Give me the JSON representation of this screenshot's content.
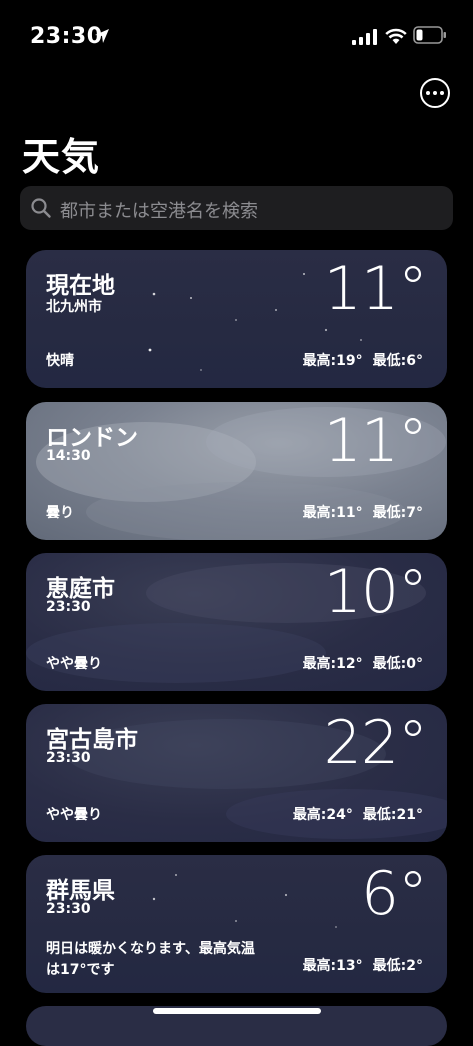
{
  "status_bar": {
    "time": "23:30"
  },
  "header": {
    "title": "天気"
  },
  "search": {
    "placeholder": "都市または空港名を検索"
  },
  "cities": [
    {
      "name": "現在地",
      "subtitle": "北九州市",
      "temp": "11°",
      "condition": "快晴",
      "high": "最高:19°",
      "low": "最低:6°",
      "theme": "night"
    },
    {
      "name": "ロンドン",
      "subtitle": "14:30",
      "temp": "11°",
      "condition": "曇り",
      "high": "最高:11°",
      "low": "最低:7°",
      "theme": "day"
    },
    {
      "name": "恵庭市",
      "subtitle": "23:30",
      "temp": "10°",
      "condition": "やや曇り",
      "high": "最高:12°",
      "low": "最低:0°",
      "theme": "cloudy-night"
    },
    {
      "name": "宮古島市",
      "subtitle": "23:30",
      "temp": "22°",
      "condition": "やや曇り",
      "high": "最高:24°",
      "low": "最低:21°",
      "theme": "cloudy-night"
    },
    {
      "name": "群馬県",
      "subtitle": "23:30",
      "temp": "6°",
      "condition_line1": "明日は暖かくなります、最高気温",
      "condition_line2": "は17°です",
      "high": "最高:13°",
      "low": "最低:2°",
      "theme": "night"
    }
  ],
  "icons": {
    "location": "location-arrow-icon",
    "signal": "cellular-signal-icon",
    "wifi": "wifi-icon",
    "battery": "battery-icon",
    "more": "ellipsis-circle-icon",
    "search": "search-icon"
  }
}
